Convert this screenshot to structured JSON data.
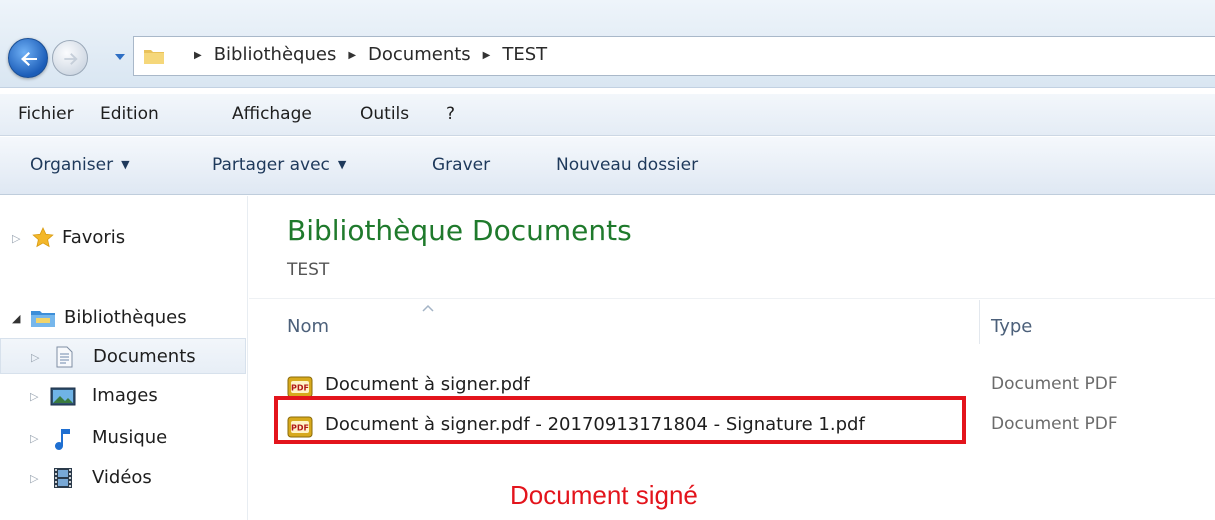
{
  "address_bar": {
    "breadcrumbs": [
      "Bibliothèques",
      "Documents",
      "TEST"
    ],
    "icons": {
      "back": "back-arrow-icon",
      "forward": "forward-arrow-icon",
      "recent": "chevron-down-icon",
      "folder": "folder-icon"
    }
  },
  "menu": {
    "items": [
      "Fichier",
      "Edition",
      "Affichage",
      "Outils",
      "?"
    ]
  },
  "toolbar": {
    "organize": "Organiser",
    "share": "Partager avec",
    "burn": "Graver",
    "new_folder": "Nouveau dossier"
  },
  "sidebar": {
    "favorites": "Favoris",
    "libraries": "Bibliothèques",
    "items": [
      {
        "label": "Documents",
        "icon": "document-library-icon",
        "selected": true
      },
      {
        "label": "Images",
        "icon": "image-library-icon"
      },
      {
        "label": "Musique",
        "icon": "music-note-icon"
      },
      {
        "label": "Vidéos",
        "icon": "film-strip-icon"
      }
    ]
  },
  "main": {
    "title": "Bibliothèque Documents",
    "subtitle": "TEST",
    "columns": {
      "name": "Nom",
      "type": "Type"
    },
    "files": [
      {
        "name": "Document à signer.pdf",
        "type": "Document PDF",
        "icon": "pdf-file-icon"
      },
      {
        "name": "Document à signer.pdf - 20170913171804 - Signature 1.pdf",
        "type": "Document PDF",
        "icon": "pdf-file-icon"
      }
    ]
  },
  "annotation": {
    "label": "Document signé",
    "color": "#e3141c"
  }
}
